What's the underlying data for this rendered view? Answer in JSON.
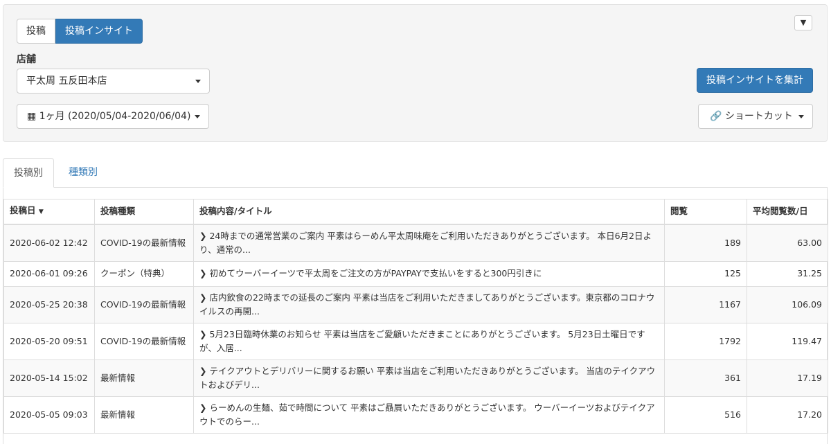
{
  "mode_buttons": [
    "投稿",
    "投稿インサイト"
  ],
  "store_label": "店舗",
  "store_value": "平太周 五反田本店",
  "date_range": "1ヶ月 (2020/05/04-2020/06/04)",
  "pin_icon": "📌",
  "aggregate_button": "投稿インサイトを集計",
  "shortcut_button": "ショートカット",
  "tabs": [
    "投稿別",
    "種類別"
  ],
  "table": {
    "headers": [
      "投稿日",
      "投稿種類",
      "投稿内容/タイトル",
      "閲覧",
      "平均閲覧数/日"
    ],
    "rows": [
      {
        "date": "2020-06-02 12:42",
        "type": "COVID-19の最新情報",
        "content": "24時までの通常営業のご案内 平素はらーめん平太周味庵をご利用いただきありがとうございます。 本日6月2日より、通常の...",
        "views": "189",
        "avg": "63.00"
      },
      {
        "date": "2020-06-01 09:26",
        "type": "クーポン（特典）",
        "content": "初めてウーバーイーツで平太周をご注文の方がPAYPAYで支払いをすると300円引きに",
        "views": "125",
        "avg": "31.25"
      },
      {
        "date": "2020-05-25 20:38",
        "type": "COVID-19の最新情報",
        "content": "店内飲食の22時までの延長のご案内 平素は当店をご利用いただきましてありがとうございます。東京都のコロナウイルスの再開...",
        "views": "1167",
        "avg": "106.09"
      },
      {
        "date": "2020-05-20 09:51",
        "type": "COVID-19の最新情報",
        "content": "5月23日臨時休業のお知らせ 平素は当店をご愛顧いただきまことにありがとうございます。 5月23日土曜日ですが、入居...",
        "views": "1792",
        "avg": "119.47"
      },
      {
        "date": "2020-05-14 15:02",
        "type": "最新情報",
        "content": "テイクアウトとデリバリーに関するお願い 平素は当店をご利用いただきありがとうございます。 当店のテイクアウトおよびデリ...",
        "views": "361",
        "avg": "17.19"
      },
      {
        "date": "2020-05-05 09:03",
        "type": "最新情報",
        "content": "らーめんの生麺、茹で時間について 平素はご贔屓いただきありがとうございます。 ウーバーイーツおよびテイクアウトでのらー...",
        "views": "516",
        "avg": "17.20"
      }
    ]
  }
}
